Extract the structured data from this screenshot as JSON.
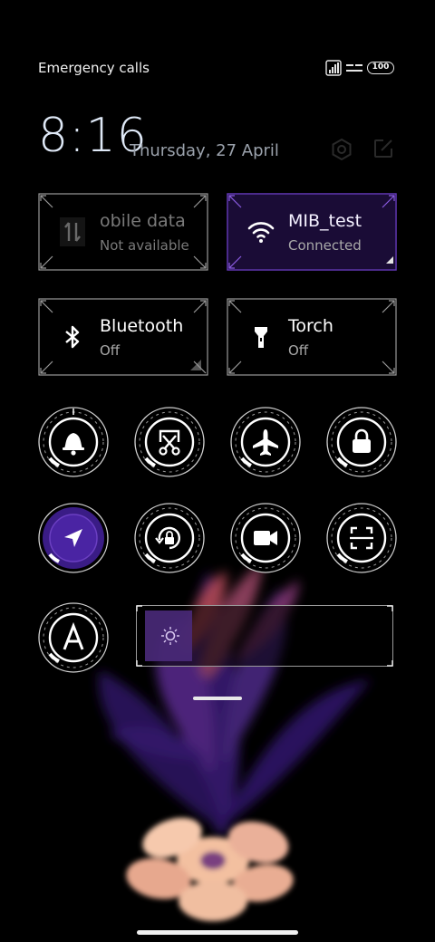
{
  "status": {
    "carrier_text": "Emergency calls o",
    "battery": "100",
    "icons": [
      "signal-icon",
      "data-icon",
      "battery-icon"
    ]
  },
  "header": {
    "time": "8:16",
    "date": "Thursday, 27 April",
    "icons": [
      "settings-icon",
      "edit-icon"
    ]
  },
  "tiles": [
    {
      "title": "obile data",
      "subtitle": "Not available",
      "icon": "mobile-data-icon",
      "state": "unavailable"
    },
    {
      "title": "MIB_test",
      "subtitle": "Connected",
      "icon": "wifi-icon",
      "state": "on"
    },
    {
      "title": "Bluetooth",
      "subtitle": "Off",
      "icon": "bluetooth-icon",
      "state": "off"
    },
    {
      "title": "Torch",
      "subtitle": "Off",
      "icon": "torch-icon",
      "state": "off"
    }
  ],
  "toggles": [
    {
      "name": "sound",
      "icon": "bell-icon",
      "active": false
    },
    {
      "name": "screenshot",
      "icon": "scissors-icon",
      "active": false
    },
    {
      "name": "airplane-mode",
      "icon": "airplane-icon",
      "active": false
    },
    {
      "name": "lock-screen",
      "icon": "lock-icon",
      "active": false
    },
    {
      "name": "location",
      "icon": "location-arrow-icon",
      "active": true
    },
    {
      "name": "rotation-lock",
      "icon": "rotation-lock-icon",
      "active": false
    },
    {
      "name": "screen-recorder",
      "icon": "video-camera-icon",
      "active": false
    },
    {
      "name": "scanner",
      "icon": "scan-icon",
      "active": false
    },
    {
      "name": "auto-brightness",
      "icon": "letter-a-icon",
      "active": false
    }
  ],
  "brightness": {
    "level": 0.1,
    "icon": "sun-icon"
  },
  "colors": {
    "accent": "#7a3fe0",
    "active_bg": "#1a0c36",
    "text_secondary": "#a9a9a9"
  }
}
